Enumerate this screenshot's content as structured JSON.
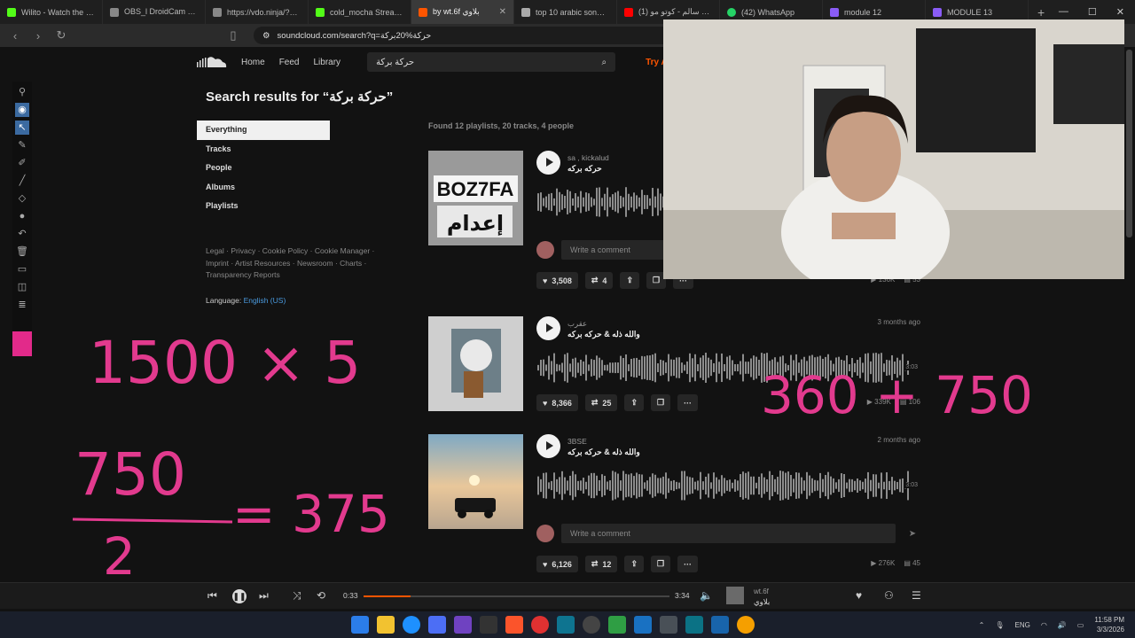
{
  "browser": {
    "tabs": [
      {
        "label": "Wilito - Watch the VOD",
        "color": "#53fc18"
      },
      {
        "label": "OBS_l DroidCam بدالل",
        "color": "#888888"
      },
      {
        "label": "https://vdo.ninja/?view",
        "color": "#888888"
      },
      {
        "label": "cold_mocha Stream - V",
        "color": "#53fc18"
      },
      {
        "label": "by wt.6f بلاوي",
        "color": "#ff5500"
      },
      {
        "label": "top 10 arabic songs 20",
        "color": "#aaaaaa"
      },
      {
        "label": "(1) سليم سالم - كوتو مو",
        "color": "#ff0000"
      },
      {
        "label": "(42) WhatsApp",
        "color": "#25d366"
      },
      {
        "label": "module 12",
        "color": "#8a5cf6"
      },
      {
        "label": "MODULE 13",
        "color": "#8a5cf6"
      }
    ],
    "url": "soundcloud.com/search?q=حركة%20بركة"
  },
  "sc_header": {
    "nav": [
      "Home",
      "Feed",
      "Library"
    ],
    "search_value": "حركة بركة",
    "try_artist": "Try Ar"
  },
  "search": {
    "title": "Search results for “حركة بركة”",
    "filters": [
      "Everything",
      "Tracks",
      "People",
      "Albums",
      "Playlists"
    ],
    "found": "Found 12 playlists, 20 tracks, 4 people"
  },
  "footer": {
    "links_line1": "Legal · Privacy · Cookie Policy · Cookie Manager ·",
    "links_line2": "Imprint · Artist Resources · Newsroom · Charts ·",
    "links_line3": "Transparency Reports",
    "language_label": "Language:",
    "language_value": "English (US)"
  },
  "tracks": [
    {
      "artist": "sa , kickalud",
      "title": "حركه بركه",
      "age": "",
      "likes": "3,508",
      "reposts": "4",
      "plays": "136K",
      "comments": "53",
      "duration": "",
      "comment_placeholder": "Write a comment"
    },
    {
      "artist": "عقرب",
      "title": "والله ذله & حركه بركه",
      "age": "3 months ago",
      "likes": "8,366",
      "reposts": "25",
      "plays": "339K",
      "comments": "106",
      "duration": "3:03",
      "comment_placeholder": ""
    },
    {
      "artist": "3BSE",
      "title": "والله ذله & حركه بركه",
      "age": "2 months ago",
      "likes": "6,126",
      "reposts": "12",
      "plays": "276K",
      "comments": "45",
      "duration": "3:03",
      "comment_placeholder": "Write a comment"
    }
  ],
  "player": {
    "elapsed": "0:33",
    "total": "3:34",
    "progress": 0.154,
    "artist": "wt.6f",
    "title": "بلاوي"
  },
  "annotations": {
    "calc1": "1500 × 5",
    "calc2": "750",
    "calc2_div": "2",
    "calc2_result": "= 375",
    "calc3": "360 + 750"
  },
  "taskbar": {
    "lang": "ENG",
    "time": "11:58 PM",
    "date": "3/3/2026"
  },
  "colors": {
    "accent": "#ff5500",
    "ink": "#e23a8e",
    "link": "#4a9be0"
  }
}
